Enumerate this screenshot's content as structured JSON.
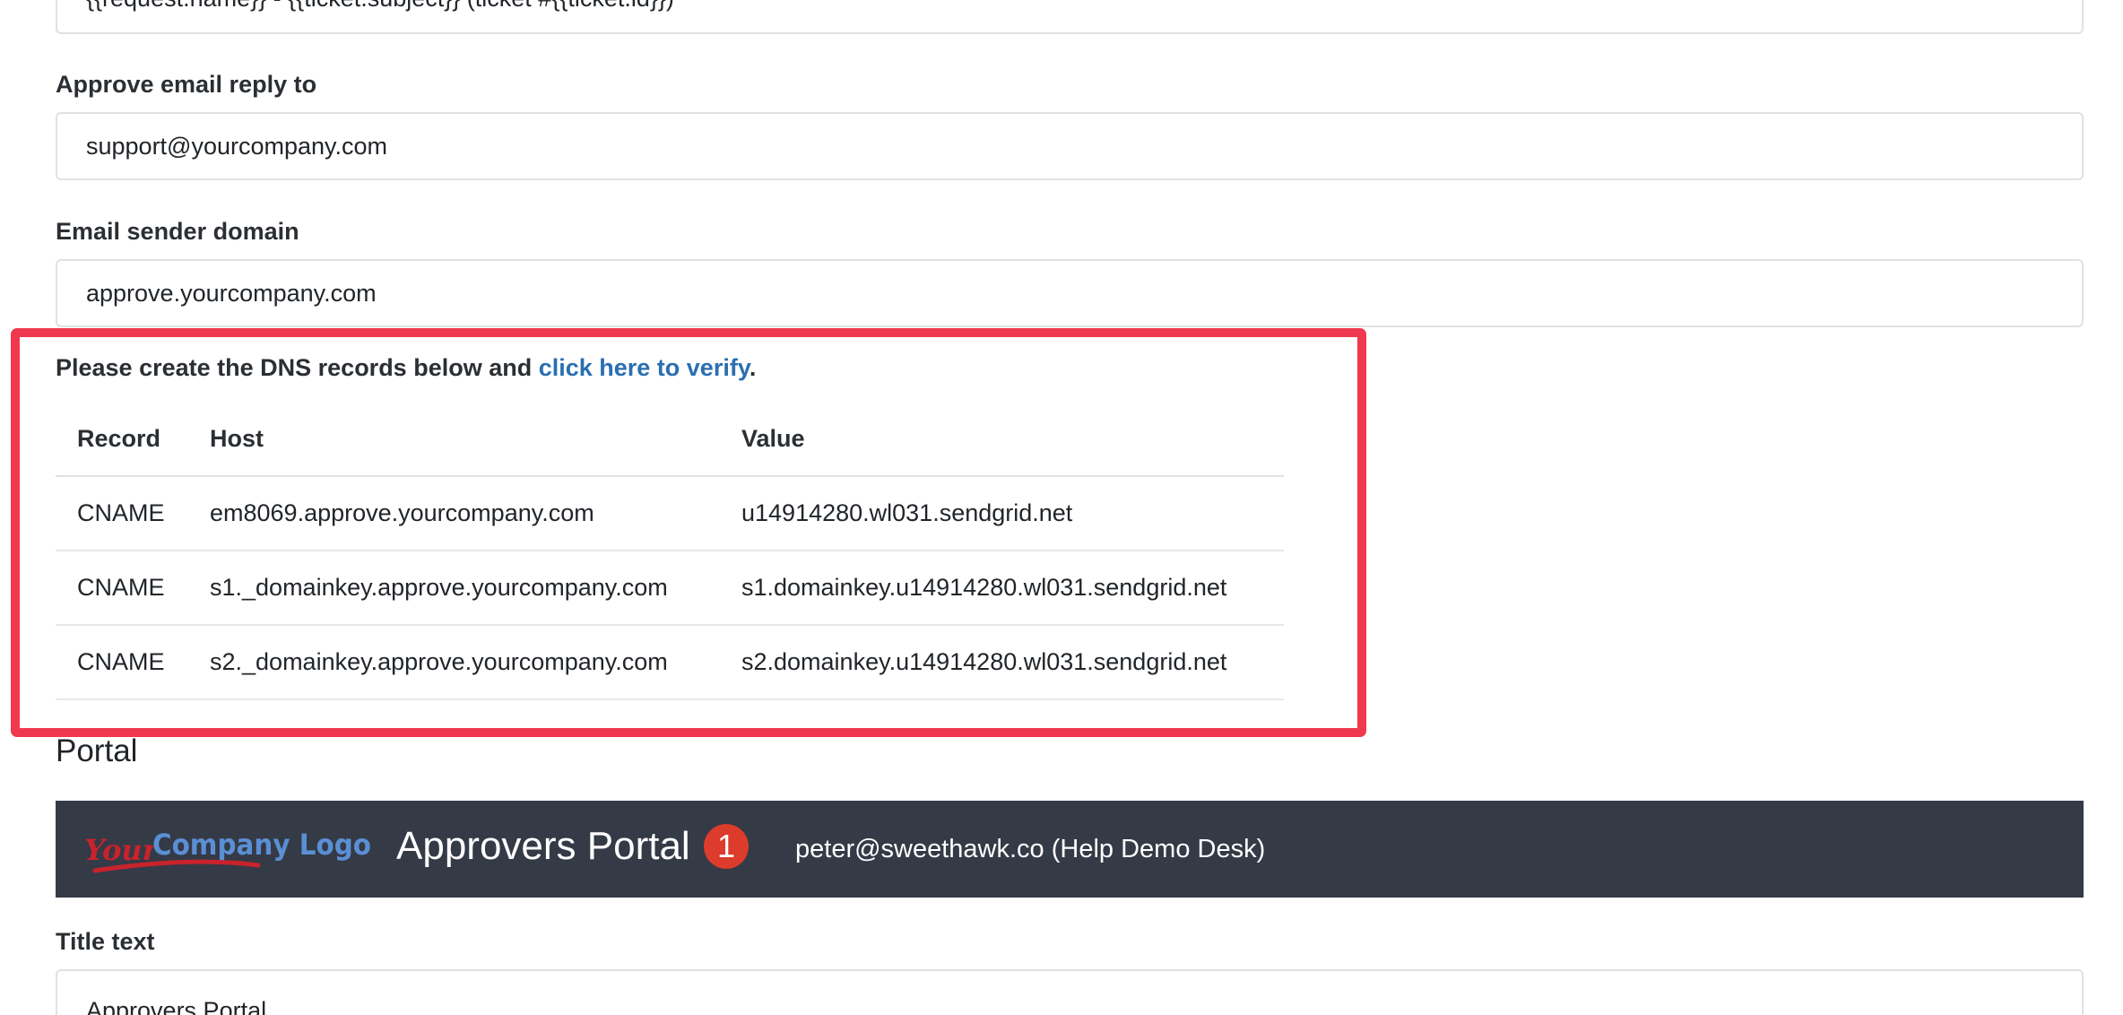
{
  "top_field": {
    "value": "{{request.name}} - {{ticket.subject}} (ticket #{{ticket.id}})"
  },
  "reply_to": {
    "label": "Approve email reply to",
    "value": "support@yourcompany.com"
  },
  "sender_domain": {
    "label": "Email sender domain",
    "value": "approve.yourcompany.com"
  },
  "dns": {
    "intro_prefix": "Please create the DNS records below and ",
    "verify_link": "click here to verify",
    "intro_suffix": ".",
    "columns": [
      "Record",
      "Host",
      "Value"
    ],
    "rows": [
      {
        "record": "CNAME",
        "host": "em8069.approve.yourcompany.com",
        "value": "u14914280.wl031.sendgrid.net"
      },
      {
        "record": "CNAME",
        "host": "s1._domainkey.approve.yourcompany.com",
        "value": "s1.domainkey.u14914280.wl031.sendgrid.net"
      },
      {
        "record": "CNAME",
        "host": "s2._domainkey.approve.yourcompany.com",
        "value": "s2.domainkey.u14914280.wl031.sendgrid.net"
      }
    ],
    "highlight_color": "#f0394e"
  },
  "portal": {
    "heading": "Portal",
    "logo_text_your": "Your",
    "logo_text_rest": "Company Logo",
    "title": "Approvers Portal",
    "badge_count": "1",
    "user": "peter@sweethawk.co (Help Demo Desk)",
    "bar_color": "#343a46"
  },
  "title_text": {
    "label": "Title text",
    "value": "Approvers Portal"
  }
}
